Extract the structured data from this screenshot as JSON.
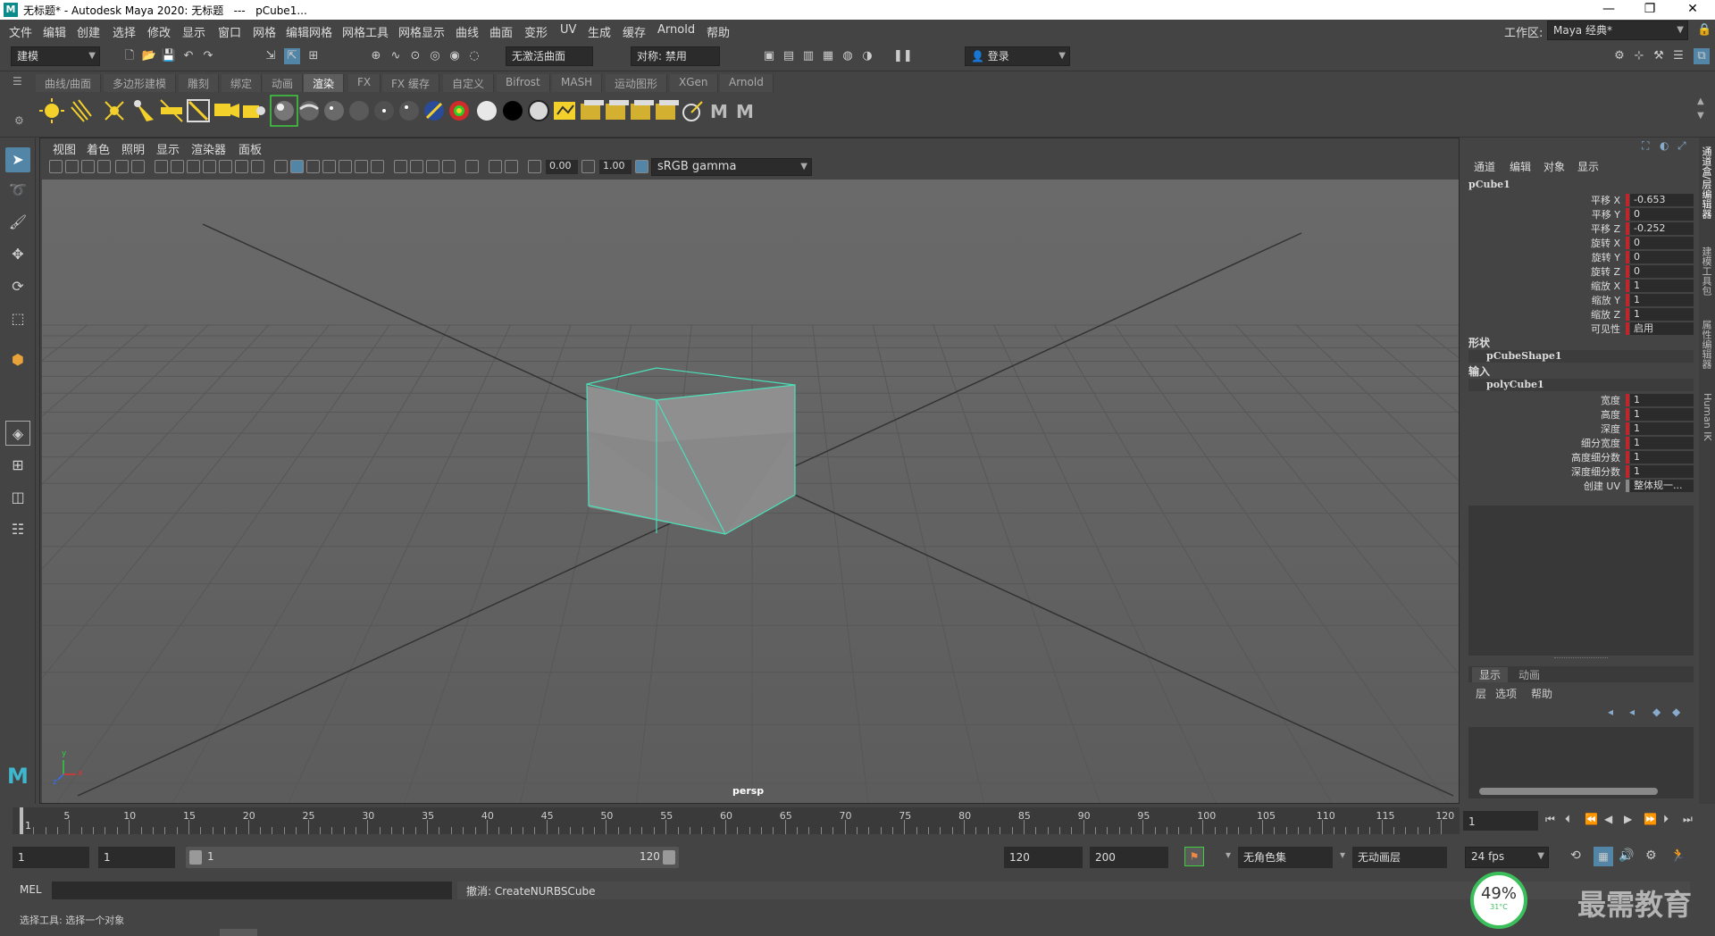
{
  "window": {
    "title": "无标题* - Autodesk Maya 2020: 无标题   ---   pCube1...",
    "logo": "M",
    "min_label": "—",
    "max_label": "❐",
    "close_label": "✕"
  },
  "menubar": {
    "items": [
      "文件",
      "编辑",
      "创建",
      "选择",
      "修改",
      "显示",
      "窗口",
      "网格",
      "编辑网格",
      "网格工具",
      "网格显示",
      "曲线",
      "曲面",
      "变形",
      "UV",
      "生成",
      "缓存",
      "Arnold",
      "帮助"
    ],
    "workspace_label": "工作区:",
    "workspace_value": "Maya 经典*"
  },
  "statusline": {
    "mode": "建模",
    "live_surface": "无激活曲面",
    "symmetry": "对称: 禁用",
    "login": "登录"
  },
  "shelf": {
    "tabs": [
      "曲线/曲面",
      "多边形建模",
      "雕刻",
      "绑定",
      "动画",
      "渲染",
      "FX",
      "FX 缓存",
      "自定义",
      "Bifrost",
      "MASH",
      "运动图形",
      "XGen",
      "Arnold"
    ],
    "active_tab": "渲染"
  },
  "viewport": {
    "menus": [
      "视图",
      "着色",
      "照明",
      "显示",
      "渲染器",
      "面板"
    ],
    "exposure": "0.00",
    "gamma": "1.00",
    "color_space": "sRGB gamma",
    "camera_label": "persp",
    "axis_y": "y",
    "axis_x": "x",
    "axis_z": "z"
  },
  "channel_box": {
    "menus": [
      "通道",
      "编辑",
      "对象",
      "显示"
    ],
    "object": "pCube1",
    "channels": [
      {
        "label": "平移 X",
        "value": "-0.653"
      },
      {
        "label": "平移 Y",
        "value": "0"
      },
      {
        "label": "平移 Z",
        "value": "-0.252"
      },
      {
        "label": "旋转 X",
        "value": "0"
      },
      {
        "label": "旋转 Y",
        "value": "0"
      },
      {
        "label": "旋转 Z",
        "value": "0"
      },
      {
        "label": "缩放 X",
        "value": "1"
      },
      {
        "label": "缩放 Y",
        "value": "1"
      },
      {
        "label": "缩放 Z",
        "value": "1"
      },
      {
        "label": "可见性",
        "value": "启用"
      }
    ],
    "shape_section": "形状",
    "shape_node": "pCubeShape1",
    "input_section": "输入",
    "input_node": "polyCube1",
    "inputs": [
      {
        "label": "宽度",
        "value": "1"
      },
      {
        "label": "高度",
        "value": "1"
      },
      {
        "label": "深度",
        "value": "1"
      },
      {
        "label": "细分宽度",
        "value": "1"
      },
      {
        "label": "高度细分数",
        "value": "1"
      },
      {
        "label": "深度细分数",
        "value": "1"
      },
      {
        "label": "创建 UV",
        "value": "整体规一..."
      }
    ]
  },
  "layer_editor": {
    "tabs": [
      "显示",
      "动画"
    ],
    "menus": [
      "层",
      "选项",
      "帮助"
    ]
  },
  "side_tabs": [
    "通道盒/层编辑器",
    "建模工具包",
    "属性编辑器",
    "Human IK"
  ],
  "timeslider": {
    "ticks": [
      "5",
      "10",
      "15",
      "20",
      "25",
      "30",
      "35",
      "40",
      "45",
      "50",
      "55",
      "60",
      "65",
      "70",
      "75",
      "80",
      "85",
      "90",
      "95",
      "100",
      "105",
      "110",
      "115",
      "120"
    ],
    "current_label": "1",
    "current_frame": "1"
  },
  "range": {
    "start": "1",
    "playback_start": "1",
    "slider_start": "1",
    "slider_end": "120",
    "playback_end": "120",
    "end": "200",
    "character_set": "无角色集",
    "anim_layer": "无动画层",
    "fps": "24 fps"
  },
  "cmdline": {
    "language": "MEL",
    "result": "撤消: CreateNURBSCube"
  },
  "helpline": {
    "text": "选择工具: 选择一个对象"
  },
  "overlay": {
    "cpu_percent": "49%",
    "temp": "31°C",
    "watermark": "最需教育"
  }
}
